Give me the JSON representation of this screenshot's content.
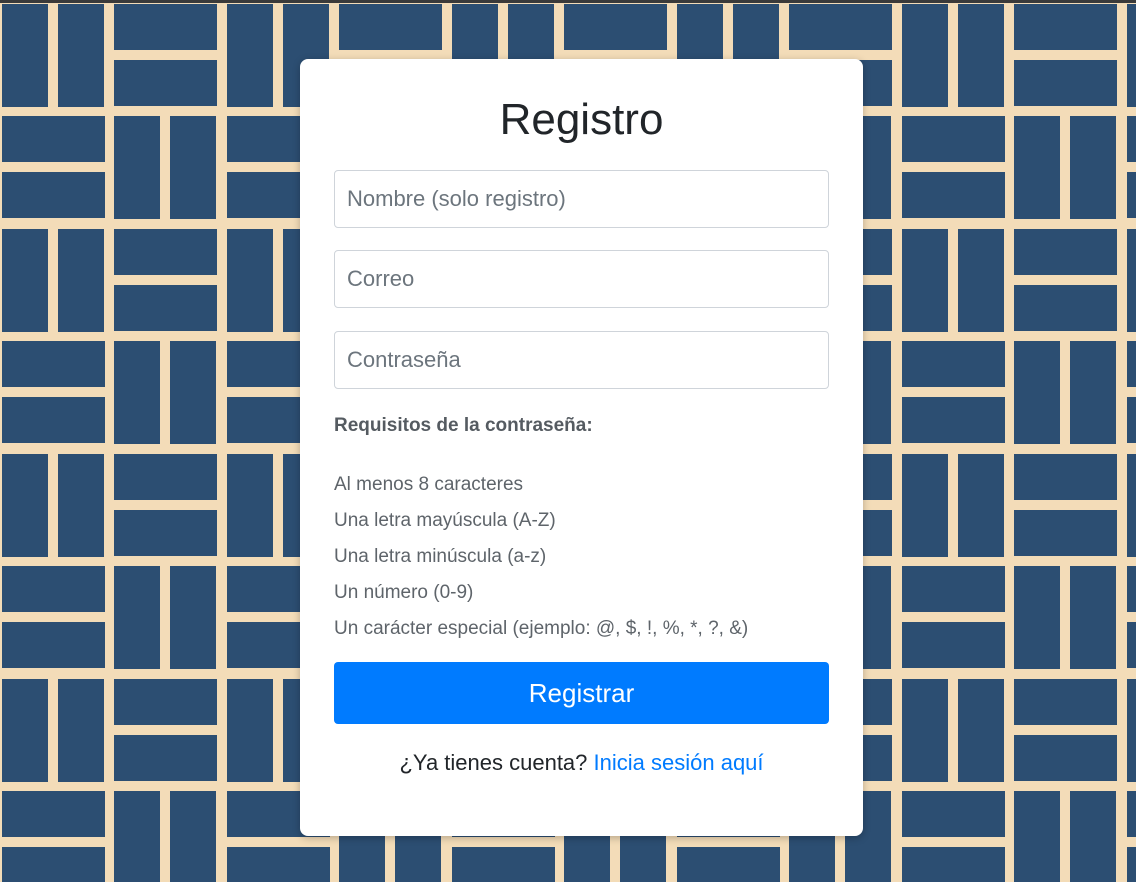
{
  "page": {
    "background_color": "#2c4e72",
    "pattern_line_color": "#f3dcb8"
  },
  "form": {
    "title": "Registro",
    "name_placeholder": "Nombre (solo registro)",
    "email_placeholder": "Correo",
    "password_placeholder": "Contraseña",
    "requirements_title": "Requisitos de la contraseña:",
    "requirements": [
      "Al menos 8 caracteres",
      "Una letra mayúscula (A-Z)",
      "Una letra minúscula (a-z)",
      "Un número (0-9)",
      "Un carácter especial (ejemplo: @, $, !, %, *, ?, &)"
    ],
    "submit_label": "Registrar",
    "login_prompt": "¿Ya tienes cuenta?",
    "login_link": "Inicia sesión aquí",
    "accent_color": "#007bff"
  }
}
